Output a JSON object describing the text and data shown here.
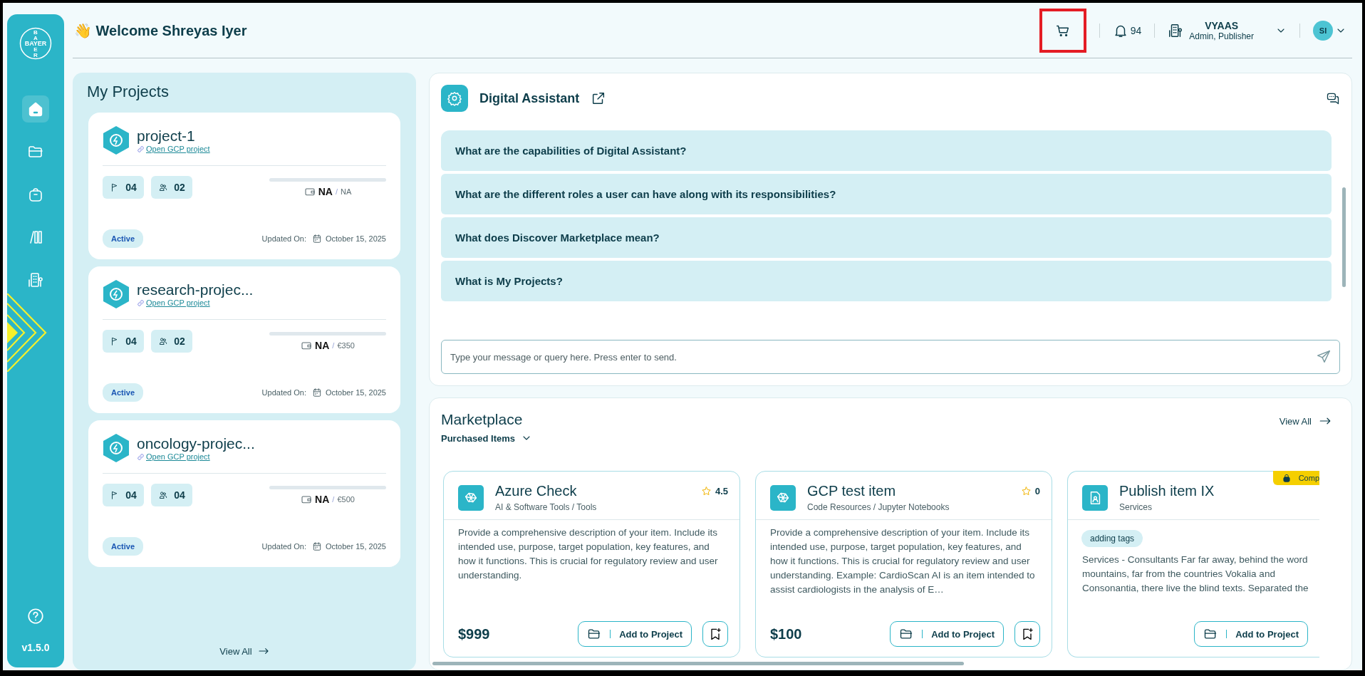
{
  "sidebar": {
    "logo_top": [
      "B",
      "A"
    ],
    "logo_text": "BAYER",
    "logo_bottom": [
      "E",
      "R"
    ],
    "items": [
      {
        "kind": "home",
        "selected": true
      },
      {
        "kind": "folder",
        "selected": false
      },
      {
        "kind": "bag",
        "selected": false
      },
      {
        "kind": "library",
        "selected": false
      },
      {
        "kind": "building",
        "selected": false
      }
    ],
    "version": "v1.5.0"
  },
  "header": {
    "wave": "👋",
    "welcome": "Welcome Shreyas Iyer",
    "cart_highlighted": true,
    "notifications": "94",
    "org": "VYAAS",
    "roles": "Admin, Publisher",
    "avatar": "SI"
  },
  "projects": {
    "title": "My Projects",
    "items": [
      {
        "name": "project-1",
        "link": "Open GCP project",
        "flags": "04",
        "members": "02",
        "level": 0,
        "spent": "NA",
        "separator": "/",
        "budget": "NA",
        "status": "Active",
        "updated_label": "Updated On:",
        "updated": "October 15, 2025"
      },
      {
        "name": "research-projec...",
        "link": "Open GCP project",
        "flags": "04",
        "members": "02",
        "level": 0,
        "spent": "NA",
        "separator": "/",
        "budget": "€350",
        "status": "Active",
        "updated_label": "Updated On:",
        "updated": "October 15, 2025"
      },
      {
        "name": "oncology-projec...",
        "link": "Open GCP project",
        "flags": "04",
        "members": "04",
        "level": 0,
        "spent": "NA",
        "separator": "/",
        "budget": "€500",
        "status": "Active",
        "updated_label": "Updated On:",
        "updated": "October 15, 2025"
      }
    ],
    "view_all": "View All"
  },
  "assistant": {
    "title": "Digital Assistant",
    "questions": [
      "What are the capabilities of Digital Assistant?",
      "What are the different roles a user can have along with its responsibilities?",
      "What does Discover Marketplace mean?",
      "What is My Projects?"
    ],
    "placeholder": "Type your message or query here. Press enter to send."
  },
  "marketplace": {
    "title": "Marketplace",
    "filter": "Purchased Items",
    "view_all": "View All",
    "items": [
      {
        "kind": "tool",
        "title": "Azure Check",
        "category": "AI & Software Tools / Tools",
        "rating": "4.5",
        "description": "Provide a comprehensive description of your item. Include its intended use, purpose, target population, key features, and how it functions. This is crucial for regulatory review and user understanding.",
        "price": "$999",
        "action": "Add to Project"
      },
      {
        "kind": "tool",
        "title": "GCP test item",
        "category": "Code Resources / Jupyter Notebooks",
        "rating": "0",
        "description": "Provide a comprehensive description of your item. Include its intended use, purpose, target population, key features, and how it functions. This is crucial for regulatory review and user understanding. Example: CardioScan AI is an item intended to assist cardiologists in the analysis of E…",
        "price": "$100",
        "action": "Add to Project"
      },
      {
        "kind": "service",
        "title": "Publish item IX",
        "category": "Services",
        "badge": "Comp",
        "tag": "adding tags",
        "description": "Services - Consultants Far far away, behind the word mountains, far from the countries Vokalia and Consonantia, there live the blind texts. Separated the",
        "action": "Add to Project"
      }
    ]
  }
}
